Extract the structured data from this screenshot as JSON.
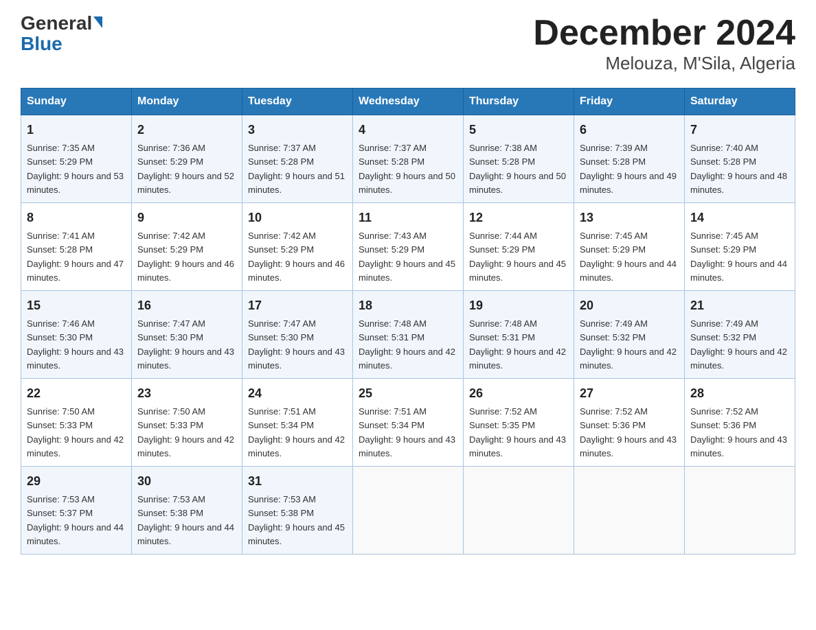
{
  "header": {
    "logo_general": "General",
    "logo_blue": "Blue",
    "title": "December 2024",
    "subtitle": "Melouza, M'Sila, Algeria"
  },
  "days_of_week": [
    "Sunday",
    "Monday",
    "Tuesday",
    "Wednesday",
    "Thursday",
    "Friday",
    "Saturday"
  ],
  "weeks": [
    [
      {
        "day": "1",
        "sunrise": "7:35 AM",
        "sunset": "5:29 PM",
        "daylight": "9 hours and 53 minutes."
      },
      {
        "day": "2",
        "sunrise": "7:36 AM",
        "sunset": "5:29 PM",
        "daylight": "9 hours and 52 minutes."
      },
      {
        "day": "3",
        "sunrise": "7:37 AM",
        "sunset": "5:28 PM",
        "daylight": "9 hours and 51 minutes."
      },
      {
        "day": "4",
        "sunrise": "7:37 AM",
        "sunset": "5:28 PM",
        "daylight": "9 hours and 50 minutes."
      },
      {
        "day": "5",
        "sunrise": "7:38 AM",
        "sunset": "5:28 PM",
        "daylight": "9 hours and 50 minutes."
      },
      {
        "day": "6",
        "sunrise": "7:39 AM",
        "sunset": "5:28 PM",
        "daylight": "9 hours and 49 minutes."
      },
      {
        "day": "7",
        "sunrise": "7:40 AM",
        "sunset": "5:28 PM",
        "daylight": "9 hours and 48 minutes."
      }
    ],
    [
      {
        "day": "8",
        "sunrise": "7:41 AM",
        "sunset": "5:28 PM",
        "daylight": "9 hours and 47 minutes."
      },
      {
        "day": "9",
        "sunrise": "7:42 AM",
        "sunset": "5:29 PM",
        "daylight": "9 hours and 46 minutes."
      },
      {
        "day": "10",
        "sunrise": "7:42 AM",
        "sunset": "5:29 PM",
        "daylight": "9 hours and 46 minutes."
      },
      {
        "day": "11",
        "sunrise": "7:43 AM",
        "sunset": "5:29 PM",
        "daylight": "9 hours and 45 minutes."
      },
      {
        "day": "12",
        "sunrise": "7:44 AM",
        "sunset": "5:29 PM",
        "daylight": "9 hours and 45 minutes."
      },
      {
        "day": "13",
        "sunrise": "7:45 AM",
        "sunset": "5:29 PM",
        "daylight": "9 hours and 44 minutes."
      },
      {
        "day": "14",
        "sunrise": "7:45 AM",
        "sunset": "5:29 PM",
        "daylight": "9 hours and 44 minutes."
      }
    ],
    [
      {
        "day": "15",
        "sunrise": "7:46 AM",
        "sunset": "5:30 PM",
        "daylight": "9 hours and 43 minutes."
      },
      {
        "day": "16",
        "sunrise": "7:47 AM",
        "sunset": "5:30 PM",
        "daylight": "9 hours and 43 minutes."
      },
      {
        "day": "17",
        "sunrise": "7:47 AM",
        "sunset": "5:30 PM",
        "daylight": "9 hours and 43 minutes."
      },
      {
        "day": "18",
        "sunrise": "7:48 AM",
        "sunset": "5:31 PM",
        "daylight": "9 hours and 42 minutes."
      },
      {
        "day": "19",
        "sunrise": "7:48 AM",
        "sunset": "5:31 PM",
        "daylight": "9 hours and 42 minutes."
      },
      {
        "day": "20",
        "sunrise": "7:49 AM",
        "sunset": "5:32 PM",
        "daylight": "9 hours and 42 minutes."
      },
      {
        "day": "21",
        "sunrise": "7:49 AM",
        "sunset": "5:32 PM",
        "daylight": "9 hours and 42 minutes."
      }
    ],
    [
      {
        "day": "22",
        "sunrise": "7:50 AM",
        "sunset": "5:33 PM",
        "daylight": "9 hours and 42 minutes."
      },
      {
        "day": "23",
        "sunrise": "7:50 AM",
        "sunset": "5:33 PM",
        "daylight": "9 hours and 42 minutes."
      },
      {
        "day": "24",
        "sunrise": "7:51 AM",
        "sunset": "5:34 PM",
        "daylight": "9 hours and 42 minutes."
      },
      {
        "day": "25",
        "sunrise": "7:51 AM",
        "sunset": "5:34 PM",
        "daylight": "9 hours and 43 minutes."
      },
      {
        "day": "26",
        "sunrise": "7:52 AM",
        "sunset": "5:35 PM",
        "daylight": "9 hours and 43 minutes."
      },
      {
        "day": "27",
        "sunrise": "7:52 AM",
        "sunset": "5:36 PM",
        "daylight": "9 hours and 43 minutes."
      },
      {
        "day": "28",
        "sunrise": "7:52 AM",
        "sunset": "5:36 PM",
        "daylight": "9 hours and 43 minutes."
      }
    ],
    [
      {
        "day": "29",
        "sunrise": "7:53 AM",
        "sunset": "5:37 PM",
        "daylight": "9 hours and 44 minutes."
      },
      {
        "day": "30",
        "sunrise": "7:53 AM",
        "sunset": "5:38 PM",
        "daylight": "9 hours and 44 minutes."
      },
      {
        "day": "31",
        "sunrise": "7:53 AM",
        "sunset": "5:38 PM",
        "daylight": "9 hours and 45 minutes."
      },
      null,
      null,
      null,
      null
    ]
  ],
  "labels": {
    "sunrise_prefix": "Sunrise: ",
    "sunset_prefix": "Sunset: ",
    "daylight_prefix": "Daylight: "
  }
}
